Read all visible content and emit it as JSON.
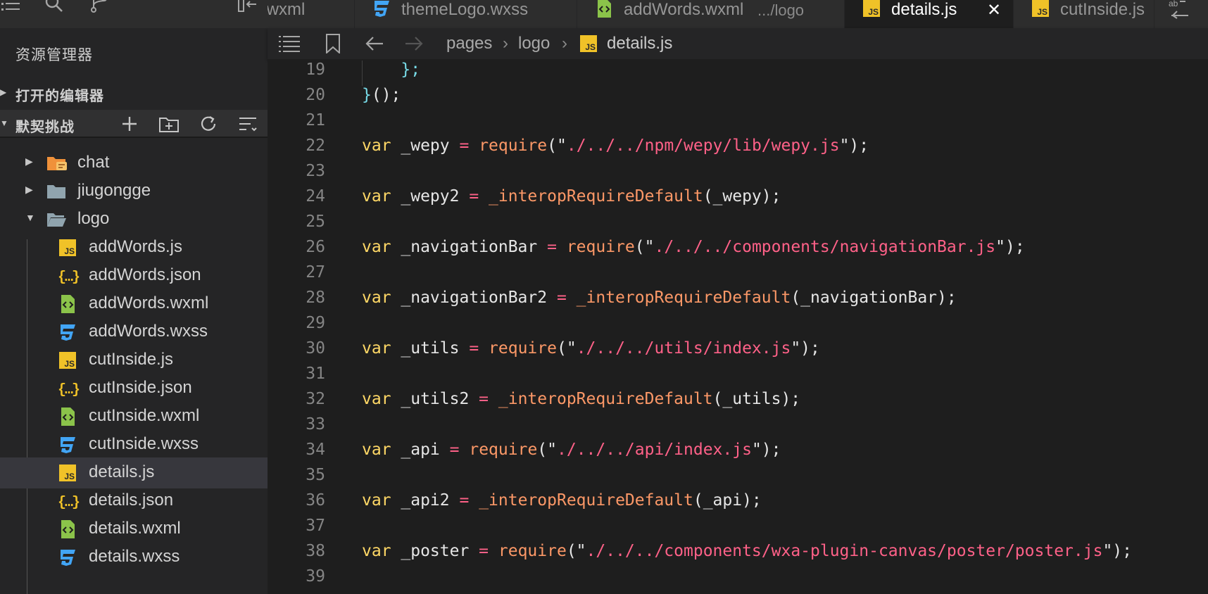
{
  "explorer": {
    "title": "资源管理器",
    "open_editors_label": "打开的编辑器",
    "project_label": "默契挑战"
  },
  "tree": [
    {
      "name": "chat",
      "type": "folder-chat",
      "state": "collapsed"
    },
    {
      "name": "jiugongge",
      "type": "folder",
      "state": "collapsed"
    },
    {
      "name": "logo",
      "type": "folder",
      "state": "expanded"
    },
    {
      "name": "addWords.js",
      "type": "js"
    },
    {
      "name": "addWords.json",
      "type": "json"
    },
    {
      "name": "addWords.wxml",
      "type": "wxml"
    },
    {
      "name": "addWords.wxss",
      "type": "wxss"
    },
    {
      "name": "cutInside.js",
      "type": "js"
    },
    {
      "name": "cutInside.json",
      "type": "json"
    },
    {
      "name": "cutInside.wxml",
      "type": "wxml"
    },
    {
      "name": "cutInside.wxss",
      "type": "wxss"
    },
    {
      "name": "details.js",
      "type": "js",
      "selected": true
    },
    {
      "name": "details.json",
      "type": "json"
    },
    {
      "name": "details.wxml",
      "type": "wxml"
    },
    {
      "name": "details.wxss",
      "type": "wxss"
    }
  ],
  "tabs": [
    {
      "name": ".wxml",
      "type": "none"
    },
    {
      "name": "themeLogo.wxss",
      "type": "wxss"
    },
    {
      "name": "addWords.wxml",
      "desc": ".../logo",
      "type": "wxml"
    },
    {
      "name": "details.js",
      "type": "js",
      "active": true
    },
    {
      "name": "cutInside.js",
      "type": "js"
    }
  ],
  "breadcrumb": {
    "parts": [
      "pages",
      "logo"
    ],
    "file": "details.js"
  },
  "editor": {
    "lines": [
      {
        "n": "19",
        "tokens": [
          {
            "c": "cb",
            "t": "    };"
          }
        ],
        "guide": true
      },
      {
        "n": "20",
        "tokens": [
          {
            "c": "cb",
            "t": "}"
          },
          {
            "c": "pn",
            "t": "();"
          }
        ]
      },
      {
        "n": "21",
        "tokens": []
      },
      {
        "n": "22",
        "tokens": [
          {
            "c": "kw",
            "t": "var"
          },
          {
            "c": "id",
            "t": " _wepy "
          },
          {
            "c": "op",
            "t": "="
          },
          {
            "c": "id",
            "t": " "
          },
          {
            "c": "fn",
            "t": "require"
          },
          {
            "c": "pn",
            "t": "(\""
          },
          {
            "c": "str",
            "t": "./../../npm/wepy/lib/wepy.js"
          },
          {
            "c": "pn",
            "t": "\");"
          }
        ]
      },
      {
        "n": "23",
        "tokens": []
      },
      {
        "n": "24",
        "tokens": [
          {
            "c": "kw",
            "t": "var"
          },
          {
            "c": "id",
            "t": " _wepy2 "
          },
          {
            "c": "op",
            "t": "="
          },
          {
            "c": "id",
            "t": " "
          },
          {
            "c": "fn",
            "t": "_interopRequireDefault"
          },
          {
            "c": "pn",
            "t": "(_wepy);"
          }
        ]
      },
      {
        "n": "25",
        "tokens": []
      },
      {
        "n": "26",
        "tokens": [
          {
            "c": "kw",
            "t": "var"
          },
          {
            "c": "id",
            "t": " _navigationBar "
          },
          {
            "c": "op",
            "t": "="
          },
          {
            "c": "id",
            "t": " "
          },
          {
            "c": "fn",
            "t": "require"
          },
          {
            "c": "pn",
            "t": "(\""
          },
          {
            "c": "str",
            "t": "./../../components/navigationBar.js"
          },
          {
            "c": "pn",
            "t": "\");"
          }
        ]
      },
      {
        "n": "27",
        "tokens": []
      },
      {
        "n": "28",
        "tokens": [
          {
            "c": "kw",
            "t": "var"
          },
          {
            "c": "id",
            "t": " _navigationBar2 "
          },
          {
            "c": "op",
            "t": "="
          },
          {
            "c": "id",
            "t": " "
          },
          {
            "c": "fn",
            "t": "_interopRequireDefault"
          },
          {
            "c": "pn",
            "t": "(_navigationBar);"
          }
        ]
      },
      {
        "n": "29",
        "tokens": []
      },
      {
        "n": "30",
        "tokens": [
          {
            "c": "kw",
            "t": "var"
          },
          {
            "c": "id",
            "t": " _utils "
          },
          {
            "c": "op",
            "t": "="
          },
          {
            "c": "id",
            "t": " "
          },
          {
            "c": "fn",
            "t": "require"
          },
          {
            "c": "pn",
            "t": "(\""
          },
          {
            "c": "str",
            "t": "./../../utils/index.js"
          },
          {
            "c": "pn",
            "t": "\");"
          }
        ]
      },
      {
        "n": "31",
        "tokens": []
      },
      {
        "n": "32",
        "tokens": [
          {
            "c": "kw",
            "t": "var"
          },
          {
            "c": "id",
            "t": " _utils2 "
          },
          {
            "c": "op",
            "t": "="
          },
          {
            "c": "id",
            "t": " "
          },
          {
            "c": "fn",
            "t": "_interopRequireDefault"
          },
          {
            "c": "pn",
            "t": "(_utils);"
          }
        ]
      },
      {
        "n": "33",
        "tokens": []
      },
      {
        "n": "34",
        "tokens": [
          {
            "c": "kw",
            "t": "var"
          },
          {
            "c": "id",
            "t": " _api "
          },
          {
            "c": "op",
            "t": "="
          },
          {
            "c": "id",
            "t": " "
          },
          {
            "c": "fn",
            "t": "require"
          },
          {
            "c": "pn",
            "t": "(\""
          },
          {
            "c": "str",
            "t": "./../../api/index.js"
          },
          {
            "c": "pn",
            "t": "\");"
          }
        ]
      },
      {
        "n": "35",
        "tokens": []
      },
      {
        "n": "36",
        "tokens": [
          {
            "c": "kw",
            "t": "var"
          },
          {
            "c": "id",
            "t": " _api2 "
          },
          {
            "c": "op",
            "t": "="
          },
          {
            "c": "id",
            "t": " "
          },
          {
            "c": "fn",
            "t": "_interopRequireDefault"
          },
          {
            "c": "pn",
            "t": "(_api);"
          }
        ]
      },
      {
        "n": "37",
        "tokens": []
      },
      {
        "n": "38",
        "tokens": [
          {
            "c": "kw",
            "t": "var"
          },
          {
            "c": "id",
            "t": " _poster "
          },
          {
            "c": "op",
            "t": "="
          },
          {
            "c": "id",
            "t": " "
          },
          {
            "c": "fn",
            "t": "require"
          },
          {
            "c": "pn",
            "t": "(\""
          },
          {
            "c": "str",
            "t": "./../../components/wxa-plugin-canvas/poster/poster.js"
          },
          {
            "c": "pn",
            "t": "\");"
          }
        ]
      },
      {
        "n": "39",
        "tokens": []
      }
    ]
  },
  "icons": {
    "menu": "menu-icon",
    "search": "search-icon",
    "source_control": "source-control-icon",
    "split": "split-icon",
    "swap": "swap-icon",
    "outline": "outline-icon",
    "bookmark": "bookmark-icon",
    "back": "back-icon",
    "forward": "forward-icon"
  },
  "colors": {
    "keyword": "#ffd866",
    "function": "#fc9867",
    "string": "#ff6188",
    "brace": "#78dce8",
    "js_badge": "#f0c228",
    "wxml": "#8bc34a",
    "wxss": "#42a5f5",
    "folder": "#90a4ae",
    "chat_folder": "#f0913a"
  }
}
